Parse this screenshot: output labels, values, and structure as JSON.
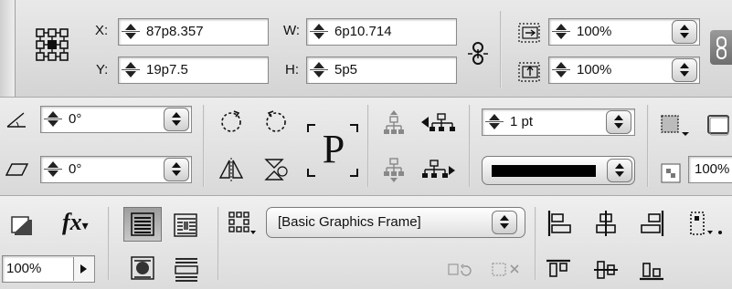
{
  "row1": {
    "x_label": "X:",
    "x_value": "87p8.357",
    "y_label": "Y:",
    "y_value": "19p7.5",
    "w_label": "W:",
    "w_value": "6p10.714",
    "h_label": "H:",
    "h_value": "5p5",
    "scale_x_value": "100%",
    "scale_y_value": "100%"
  },
  "row2": {
    "rotation_value": "0°",
    "shear_value": "0°",
    "stroke_weight_value": "1 pt",
    "opacity_value_partial": "100%",
    "text_glyph": "P"
  },
  "row3": {
    "opacity_value": "100%",
    "fx_label": "fx",
    "object_style": "[Basic Graphics Frame]"
  }
}
